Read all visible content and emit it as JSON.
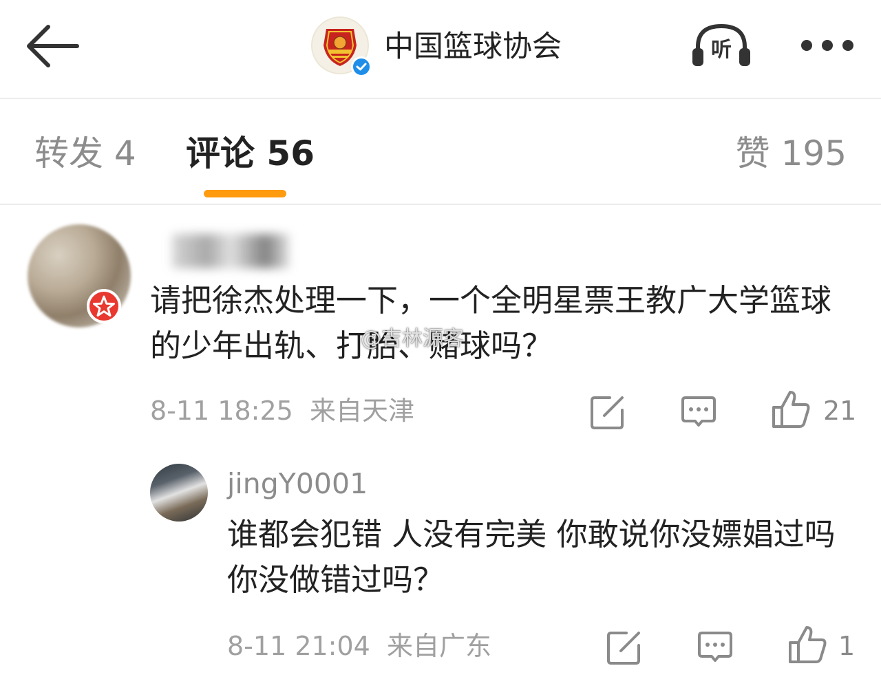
{
  "header": {
    "title": "中国篮球协会",
    "back_icon": "arrow-left-icon",
    "listen_label": "听",
    "more_icon": "more-dots-icon",
    "verified_mark": "✓"
  },
  "tabs": {
    "repost": "转发 4",
    "comments": "评论 56",
    "likes": "赞 195",
    "accent_color": "#ff9b0f"
  },
  "comments": [
    {
      "text": "请把徐杰处理一下，一个全明星票王教广大学篮球的少年出轨、打胎、赌球吗？",
      "time": "8-11 18:25",
      "location": "来自天津",
      "likes": "21"
    }
  ],
  "reply": {
    "username": "jingY0001",
    "text": "谁都会犯错  人没有完美 你敢说你没嫖娼过吗 你没做错过吗？",
    "time": "8-11 21:04",
    "location": "来自广东",
    "likes": "1"
  },
  "watermark": "@吉林源客"
}
